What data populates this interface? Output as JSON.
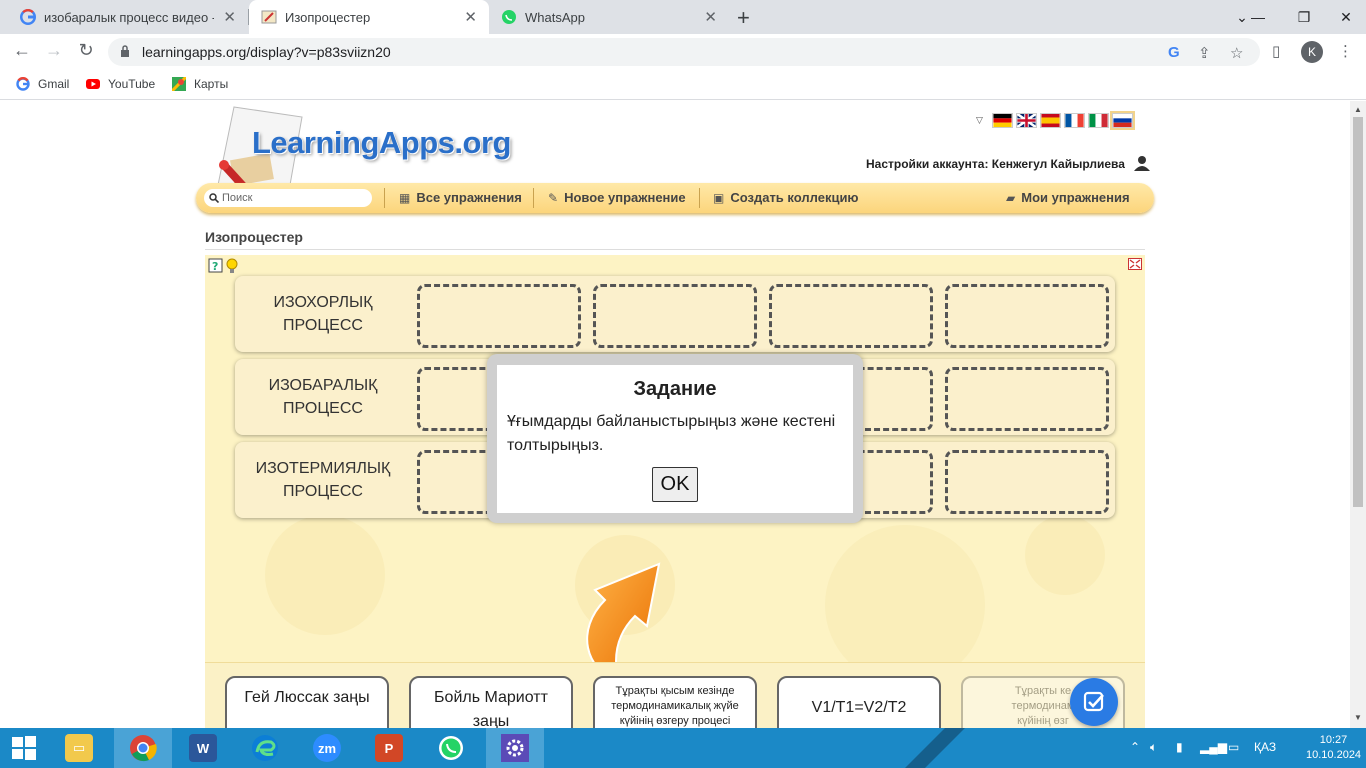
{
  "browser": {
    "tabs": [
      {
        "title": "изобаралык процесс видео - По",
        "icon": "google-icon"
      },
      {
        "title": "Изопроцестер",
        "icon": "learningapps-icon"
      },
      {
        "title": "WhatsApp",
        "icon": "whatsapp-icon"
      }
    ],
    "url": "learningapps.org/display?v=p83sviizn20",
    "avatar_letter": "K",
    "bookmarks": [
      {
        "label": "Gmail",
        "icon": "google-icon"
      },
      {
        "label": "YouTube",
        "icon": "youtube-icon"
      },
      {
        "label": "Карты",
        "icon": "maps-icon"
      }
    ]
  },
  "site": {
    "logo_text": "LearningApps.org",
    "account_text": "Настройки аккаунта: Кенжегул Кайырлиева",
    "search_placeholder": "Поиск",
    "nav": {
      "all_exercises": "Все упражнения",
      "new_exercise": "Новое упражнение",
      "create_collection": "Создать коллекцию",
      "my_exercises": "Мои упражнения"
    },
    "app_title": "Изопроцестер"
  },
  "app": {
    "rows": [
      {
        "label_line1": "ИЗОХОРЛЫҚ",
        "label_line2": "ПРОЦЕСС"
      },
      {
        "label_line1": "ИЗОБАРАЛЫҚ",
        "label_line2": "ПРОЦЕСС"
      },
      {
        "label_line1": "ИЗОТЕРМИЯЛЫҚ",
        "label_line2": "ПРОЦЕСС"
      }
    ],
    "cards": [
      {
        "text_line1": "Гей Люссак заңы",
        "text_line2": "",
        "style": "big"
      },
      {
        "text_line1": "Бойль Мариотт",
        "text_line2": "заңы",
        "style": "big"
      },
      {
        "text_line1": "Тұрақты қысым кезінде",
        "text_line2": "термодинамикалық жүйе",
        "text_line3": "күйінің өзгеру процесі",
        "style": "small"
      },
      {
        "text_line1": "V1/T1=V2/T2",
        "text_line2": "",
        "style": "big"
      },
      {
        "text_line1": "Тұрақты ке",
        "text_line2": "термодинам",
        "text_line3": "күйінің өзг",
        "style": "small"
      }
    ]
  },
  "modal": {
    "title": "Задание",
    "text": "Ұғымдарды байланыстырыңыз және кестені толтырыңыз.",
    "ok_label": "OK"
  },
  "taskbar": {
    "language": "ҚАЗ",
    "time": "10:27",
    "date": "10.10.2024",
    "apps": [
      "file-explorer-icon",
      "chrome-icon",
      "word-icon",
      "edge-icon",
      "zoom-icon",
      "powerpoint-icon",
      "whatsapp-icon",
      "settings-icon"
    ]
  },
  "colors": {
    "accent_blue": "#2a7be4",
    "app_bg": "#fdf3c4",
    "taskbar": "#1b89c7",
    "arrow_orange": "#f08a1c"
  }
}
